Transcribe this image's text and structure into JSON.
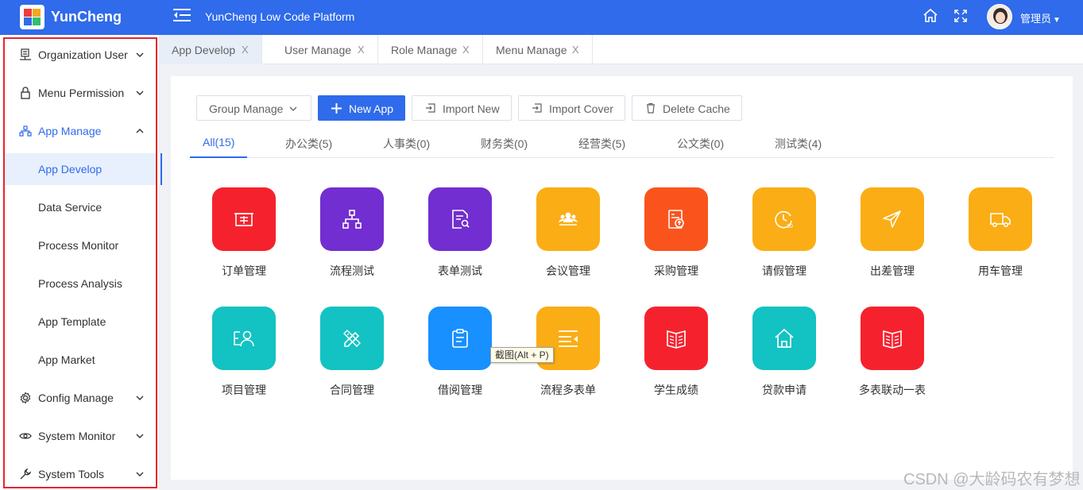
{
  "header": {
    "brand": "YunCheng",
    "platform_title": "YunCheng Low Code Platform",
    "user_name": "管理员",
    "colors": {
      "primary": "#2f6bea",
      "logo": [
        "#f03b3b",
        "#f5a623",
        "#2f6bea",
        "#2fbf71"
      ]
    },
    "icons": [
      "menu-fold-icon",
      "home-icon",
      "fullscreen-icon",
      "user-avatar",
      "caret-down-icon"
    ]
  },
  "sidebar": {
    "items": [
      {
        "label": "Organization User",
        "icon": "org-icon",
        "expandable": true
      },
      {
        "label": "Menu Permission",
        "icon": "lock-icon",
        "expandable": true
      },
      {
        "label": "App Manage",
        "icon": "app-tree-icon",
        "expandable": true,
        "open": true
      },
      {
        "label": "App Develop",
        "sub": true,
        "active": true
      },
      {
        "label": "Data Service",
        "sub": true
      },
      {
        "label": "Process Monitor",
        "sub": true
      },
      {
        "label": "Process Analysis",
        "sub": true
      },
      {
        "label": "App Template",
        "sub": true
      },
      {
        "label": "App Market",
        "sub": true
      },
      {
        "label": "Config Manage",
        "icon": "gear-icon",
        "expandable": true
      },
      {
        "label": "System Monitor",
        "icon": "eye-icon",
        "expandable": true
      },
      {
        "label": "System Tools",
        "icon": "wrench-icon",
        "expandable": true
      }
    ]
  },
  "tabs": [
    {
      "label": "App Develop",
      "close": "X",
      "active": true
    },
    {
      "label": "User Manage",
      "close": "X"
    },
    {
      "label": "Role Manage",
      "close": "X"
    },
    {
      "label": "Menu Manage",
      "close": "X"
    }
  ],
  "toolbar": {
    "group_manage": "Group Manage",
    "new_app": "New App",
    "import_new": "Import New",
    "import_cover": "Import Cover",
    "delete_cache": "Delete Cache"
  },
  "categories": [
    {
      "label": "All(15)",
      "active": true
    },
    {
      "label": "办公类(5)"
    },
    {
      "label": "人事类(0)"
    },
    {
      "label": "财务类(0)"
    },
    {
      "label": "经营类(5)"
    },
    {
      "label": "公文类(0)"
    },
    {
      "label": "测试类(4)"
    }
  ],
  "apps": [
    {
      "name": "订单管理",
      "icon": "receipt-icon",
      "color": "#f5222d"
    },
    {
      "name": "流程测试",
      "icon": "hierarchy-icon",
      "color": "#722ed1"
    },
    {
      "name": "表单测试",
      "icon": "form-search-icon",
      "color": "#722ed1"
    },
    {
      "name": "会议管理",
      "icon": "meeting-icon",
      "color": "#faad14"
    },
    {
      "name": "采购管理",
      "icon": "purchase-icon",
      "color": "#fa541c"
    },
    {
      "name": "请假管理",
      "icon": "clock-30-icon",
      "color": "#faad14"
    },
    {
      "name": "出差管理",
      "icon": "paper-plane-icon",
      "color": "#faad14"
    },
    {
      "name": "用车管理",
      "icon": "truck-icon",
      "color": "#faad14"
    },
    {
      "name": "项目管理",
      "icon": "project-user-icon",
      "color": "#13c2c2"
    },
    {
      "name": "合同管理",
      "icon": "ruler-pencil-icon",
      "color": "#13c2c2"
    },
    {
      "name": "借阅管理",
      "icon": "clipboard-icon",
      "color": "#1890ff"
    },
    {
      "name": "流程多表单",
      "icon": "list-indent-icon",
      "color": "#faad14"
    },
    {
      "name": "学生成绩",
      "icon": "open-book-icon",
      "color": "#f5222d"
    },
    {
      "name": "贷款申请",
      "icon": "house-icon",
      "color": "#13c2c2"
    },
    {
      "name": "多表联动一表",
      "icon": "open-book-icon",
      "color": "#f5222d"
    }
  ],
  "tooltip": "截图(Alt + P)",
  "watermark": "CSDN @大龄码农有梦想"
}
